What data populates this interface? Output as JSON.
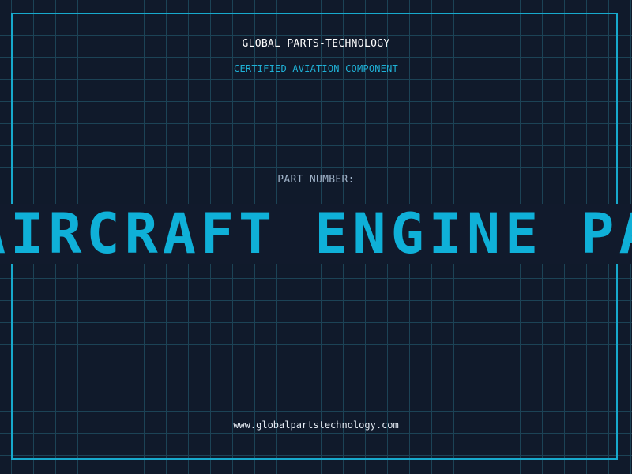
{
  "header": {
    "company": "GLOBAL PARTS-TECHNOLOGY",
    "tagline": "CERTIFIED AVIATION COMPONENT"
  },
  "part": {
    "label": "PART NUMBER:",
    "value": "AIRCRAFT ENGINE PARTS"
  },
  "footer": {
    "url": "www.globalpartstechnology.com"
  },
  "colors": {
    "background": "#101a2b",
    "grid": "#1c4356",
    "accent": "#17a9cc",
    "banner_text": "#0fb0d8"
  }
}
